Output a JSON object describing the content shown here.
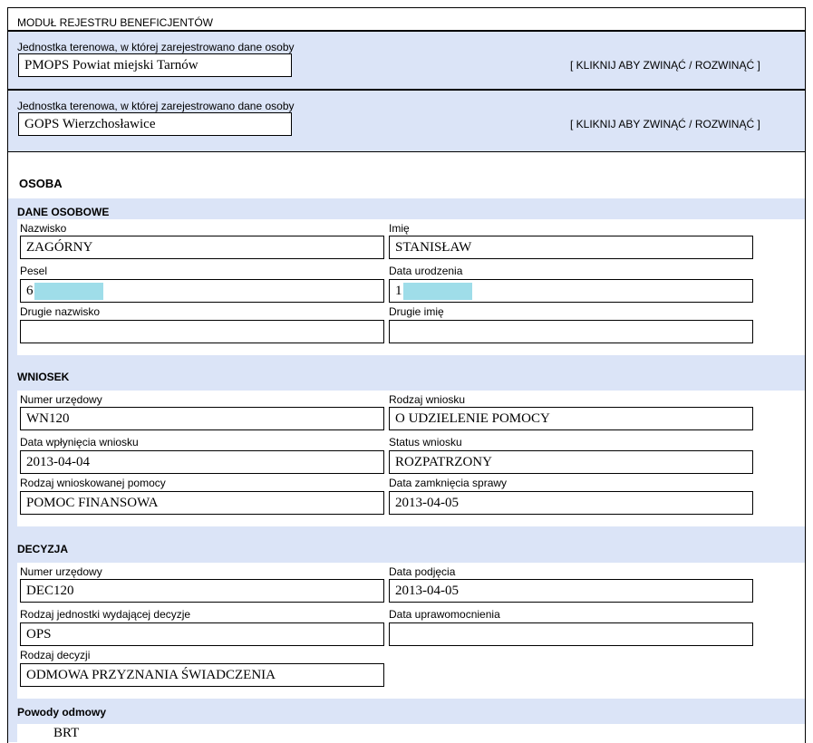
{
  "module_title": "MODUŁ REJESTRU BENEFICJENTÓW",
  "units": [
    {
      "label": "Jednostka terenowa, w której zarejestrowano dane osoby",
      "value": "PMOPS Powiat miejski Tarnów",
      "toggle": "[ KLIKNIJ ABY ZWINĄĆ / ROZWINĄĆ ]"
    },
    {
      "label": "Jednostka terenowa, w której zarejestrowano dane osoby",
      "value": "GOPS Wierzchosławice",
      "toggle": "[ KLIKNIJ ABY ZWINĄĆ / ROZWINĄĆ ]"
    }
  ],
  "person_heading": "OSOBA",
  "dane_osobowe": {
    "heading": "DANE OSOBOWE",
    "nazwisko": {
      "label": "Nazwisko",
      "value": "ZAGÓRNY"
    },
    "imie": {
      "label": "Imię",
      "value": "STANISŁAW"
    },
    "pesel": {
      "label": "Pesel",
      "value": "6"
    },
    "data_urodzenia": {
      "label": "Data urodzenia",
      "value": "1"
    },
    "drugie_nazwisko": {
      "label": "Drugie nazwisko",
      "value": ""
    },
    "drugie_imie": {
      "label": "Drugie imię",
      "value": ""
    }
  },
  "wniosek": {
    "heading": "WNIOSEK",
    "numer": {
      "label": "Numer urzędowy",
      "value": "WN120"
    },
    "rodzaj": {
      "label": "Rodzaj wniosku",
      "value": "O UDZIELENIE POMOCY"
    },
    "data_wplyniecia": {
      "label": "Data wpłynięcia wniosku",
      "value": "2013-04-04"
    },
    "status": {
      "label": "Status wniosku",
      "value": "ROZPATRZONY"
    },
    "rodzaj_pomocy": {
      "label": "Rodzaj wnioskowanej pomocy",
      "value": "POMOC FINANSOWA"
    },
    "data_zamkniecia": {
      "label": "Data zamknięcia sprawy",
      "value": "2013-04-05"
    }
  },
  "decyzja": {
    "heading": "DECYZJA",
    "numer": {
      "label": "Numer urzędowy",
      "value": "DEC120"
    },
    "data_podjecia": {
      "label": "Data podjęcia",
      "value": "2013-04-05"
    },
    "rodzaj_jednostki": {
      "label": "Rodzaj jednostki wydającej decyzje",
      "value": "OPS"
    },
    "data_uprawomocnienia": {
      "label": "Data uprawomocnienia",
      "value": ""
    },
    "rodzaj_decyzji": {
      "label": "Rodzaj decyzji",
      "value": "ODMOWA PRZYZNANIA ŚWIADCZENIA"
    }
  },
  "powody": {
    "heading": "Powody odmowy",
    "partial_value": "BRT"
  },
  "colors": {
    "section_bg": "#dbe4f7",
    "mask": "#9fdde9"
  }
}
